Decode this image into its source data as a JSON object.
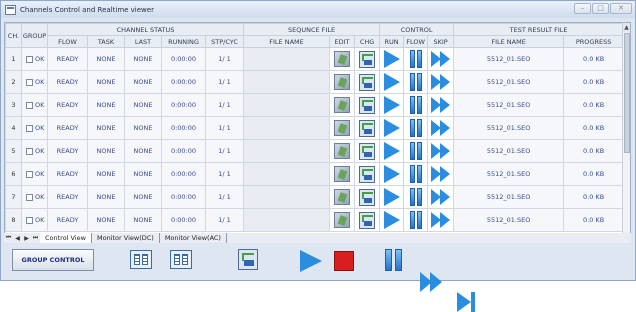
{
  "window": {
    "title": "Channels Control and Realtime viewer",
    "controls": [
      "–",
      "□",
      "✕"
    ]
  },
  "grid": {
    "group_headers": {
      "ch": "CH.",
      "group": "GROUP",
      "channel_status": "CHANNEL STATUS",
      "sequence_file": "SEQUNCE FILE",
      "control": "CONTROL",
      "test_result_file": "TEST RESULT FILE"
    },
    "columns": {
      "flow": "FLOW",
      "task": "TASK",
      "last": "LAST",
      "running": "RUNNING",
      "stp_cyc": "STP/CYC",
      "file_name": "FILE NAME",
      "edit": "EDIT",
      "chg": "CHG",
      "run": "RUN",
      "flow_ctl": "FLOW",
      "skip": "SKIP",
      "result_file_name": "FILE NAME",
      "progress": "PROGRESS"
    },
    "rows": [
      {
        "ch": "1",
        "group": "OK",
        "flow": "READY",
        "task": "NONE",
        "last": "NONE",
        "running": "0:00:00",
        "stp_cyc": "1/ 1",
        "file_name": "",
        "result_file": "5512_01.SEO",
        "progress": "0.0 KB"
      },
      {
        "ch": "2",
        "group": "OK",
        "flow": "READY",
        "task": "NONE",
        "last": "NONE",
        "running": "0:00:00",
        "stp_cyc": "1/ 1",
        "file_name": "",
        "result_file": "5512_01.SEO",
        "progress": "0.0 KB"
      },
      {
        "ch": "3",
        "group": "OK",
        "flow": "READY",
        "task": "NONE",
        "last": "NONE",
        "running": "0:00:00",
        "stp_cyc": "1/ 1",
        "file_name": "",
        "result_file": "5512_01.SEO",
        "progress": "0.0 KB"
      },
      {
        "ch": "4",
        "group": "OK",
        "flow": "READY",
        "task": "NONE",
        "last": "NONE",
        "running": "0:00:00",
        "stp_cyc": "1/ 1",
        "file_name": "",
        "result_file": "5512_01.SEO",
        "progress": "0.0 KB"
      },
      {
        "ch": "5",
        "group": "OK",
        "flow": "READY",
        "task": "NONE",
        "last": "NONE",
        "running": "0:00:00",
        "stp_cyc": "1/ 1",
        "file_name": "",
        "result_file": "5512_01.SEO",
        "progress": "0.0 KB"
      },
      {
        "ch": "6",
        "group": "OK",
        "flow": "READY",
        "task": "NONE",
        "last": "NONE",
        "running": "0:00:00",
        "stp_cyc": "1/ 1",
        "file_name": "",
        "result_file": "5512_01.SEO",
        "progress": "0.0 KB"
      },
      {
        "ch": "7",
        "group": "OK",
        "flow": "READY",
        "task": "NONE",
        "last": "NONE",
        "running": "0:00:00",
        "stp_cyc": "1/ 1",
        "file_name": "",
        "result_file": "5512_01.SEO",
        "progress": "0.0 KB"
      },
      {
        "ch": "8",
        "group": "OK",
        "flow": "READY",
        "task": "NONE",
        "last": "NONE",
        "running": "0:00:00",
        "stp_cyc": "1/ 1",
        "file_name": "",
        "result_file": "5512_01.SEO",
        "progress": "0.0 KB"
      }
    ]
  },
  "sheet_tabs": {
    "nav": [
      "⏮",
      "◀",
      "▶",
      "⏭"
    ],
    "tabs": [
      "Control View",
      "Monitor View(DC)",
      "Monitor View(AC)"
    ],
    "active": "Control View"
  },
  "bottom": {
    "group_control_label": "GROUP CONTROL"
  },
  "colors": {
    "accent": "#2a8de0",
    "stop": "#d81e1e",
    "value_text": "#3b4a8c",
    "group_button_text": "#1d2e86"
  }
}
